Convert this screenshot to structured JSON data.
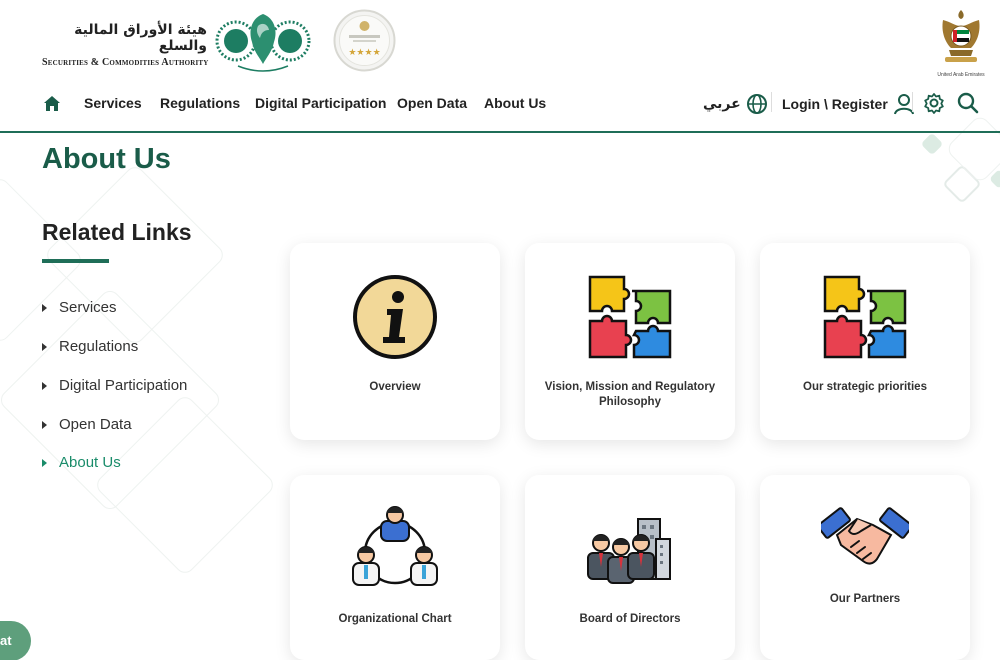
{
  "header": {
    "logo_arabic": "هيئة الأوراق المالية والسلع",
    "logo_english": "Securities & Commodities Authority",
    "uae_label": "United Arab Emirates"
  },
  "nav": {
    "items": [
      {
        "label": "Services"
      },
      {
        "label": "Regulations"
      },
      {
        "label": "Digital Participation"
      },
      {
        "label": "Open Data"
      },
      {
        "label": "About Us"
      }
    ],
    "language": "عربي",
    "login": "Login \\ Register"
  },
  "page": {
    "title": "About Us",
    "related_title": "Related Links"
  },
  "sidebar": {
    "links": [
      {
        "label": "Services"
      },
      {
        "label": "Regulations"
      },
      {
        "label": "Digital Participation"
      },
      {
        "label": "Open Data"
      },
      {
        "label": "About Us"
      }
    ]
  },
  "cards": [
    {
      "label": "Overview",
      "icon": "info-icon"
    },
    {
      "label": "Vision, Mission and Regulatory Philosophy",
      "icon": "puzzle-icon"
    },
    {
      "label": "Our strategic priorities",
      "icon": "puzzle-icon"
    },
    {
      "label": "Organizational Chart",
      "icon": "org-chart-icon"
    },
    {
      "label": "Board of Directors",
      "icon": "board-icon"
    },
    {
      "label": "Our Partners",
      "icon": "handshake-icon"
    }
  ],
  "chat": {
    "label": "at"
  },
  "colors": {
    "brand": "#1a5c49",
    "active": "#1a8c6a",
    "chat": "#5e9f7c"
  }
}
